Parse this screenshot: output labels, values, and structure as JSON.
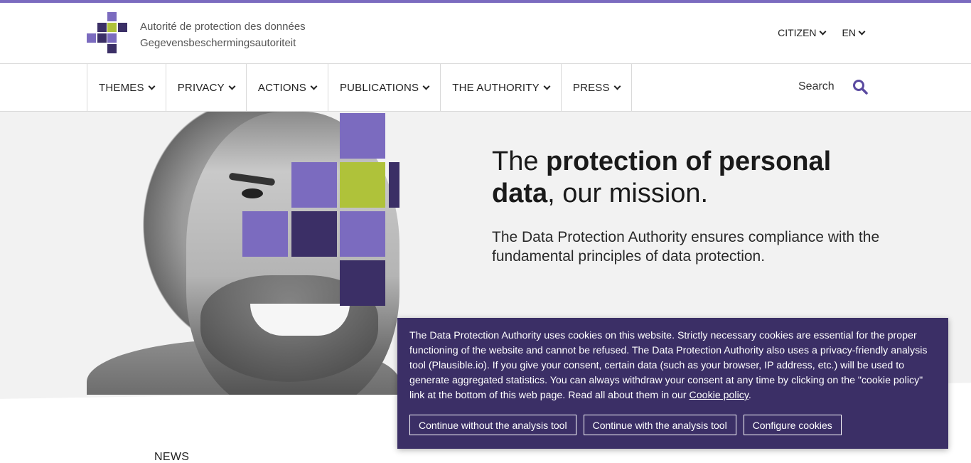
{
  "colors": {
    "accent": "#7b6bbf",
    "purple_light": "#7b6bbf",
    "purple_dark": "#3b2f66",
    "lime": "#afc23a",
    "banner_bg": "#3b2f66"
  },
  "header": {
    "org_name_fr": "Autorité de protection des données",
    "org_name_nl": "Gegevensbeschermingsautoriteit",
    "audience_label": "CITIZEN",
    "language_label": "EN"
  },
  "nav": {
    "items": [
      {
        "label": "THEMES"
      },
      {
        "label": "PRIVACY"
      },
      {
        "label": "ACTIONS"
      },
      {
        "label": "PUBLICATIONS"
      },
      {
        "label": "THE AUTHORITY"
      },
      {
        "label": "PRESS"
      }
    ],
    "search_label": "Search",
    "search_icon": "magnifier-icon"
  },
  "hero": {
    "title_pre": "The ",
    "title_bold": "protection of personal data",
    "title_post": ", our mission.",
    "text": "The Data Protection Authority ensures compliance with the fundamental principles of data protection."
  },
  "news": {
    "label": "NEWS"
  },
  "cookie_banner": {
    "text": "The Data Protection Authority uses cookies on this website. Strictly necessary cookies are essential for the proper functioning of the website and cannot be refused. The Data Protection Authority also uses a privacy-friendly analysis tool (Plausible.io). If you give your consent, certain data (such as your browser, IP address, etc.) will be used to generate aggregated statistics. You can always withdraw your consent at any time by clicking on the \"cookie policy\" link at the bottom of this web page. Read all about them in our ",
    "link_text": "Cookie policy",
    "text_end": ".",
    "buttons": {
      "without": "Continue without the analysis tool",
      "with": "Continue with the analysis tool",
      "configure": "Configure cookies"
    }
  }
}
